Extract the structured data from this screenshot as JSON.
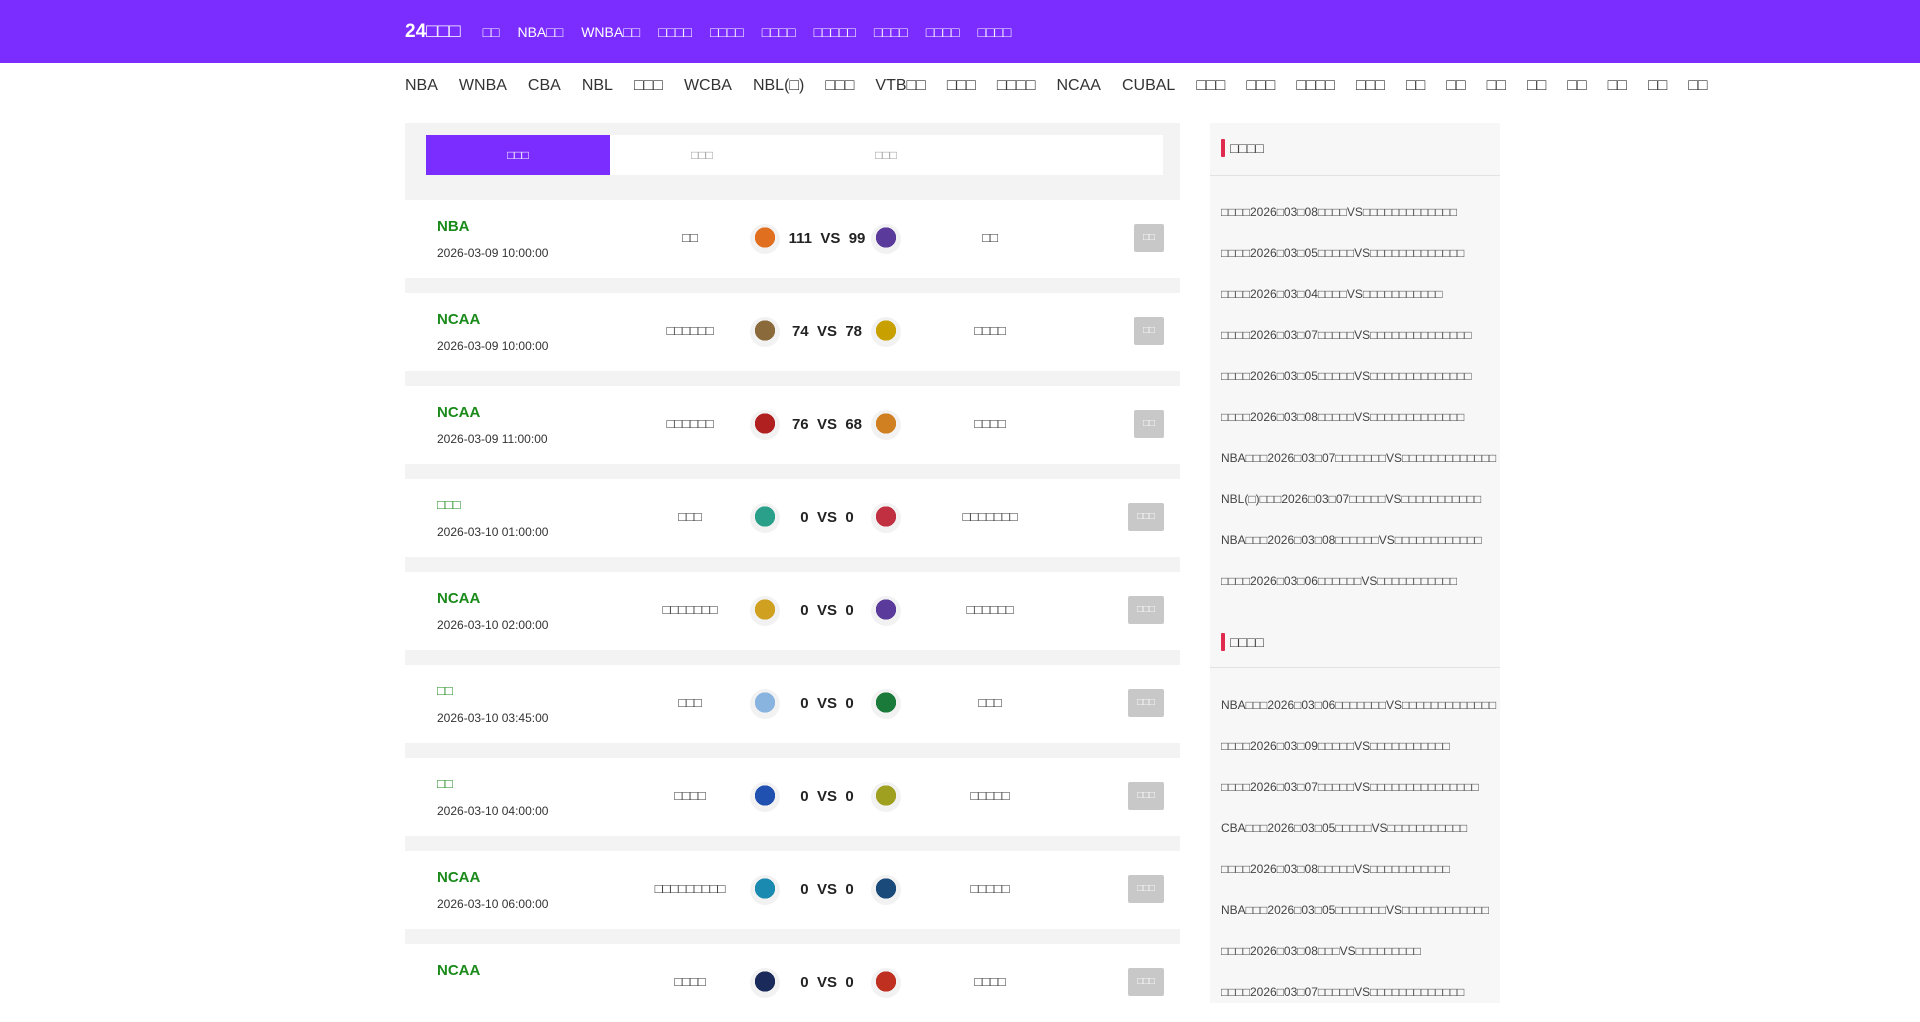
{
  "header": {
    "brand": "24□□□",
    "nav": [
      "□□",
      "NBA□□",
      "WNBA□□",
      "□□□□",
      "□□□□",
      "□□□□",
      "□□□□□",
      "□□□□",
      "□□□□",
      "□□□□"
    ]
  },
  "leagues": [
    "NBA",
    "WNBA",
    "CBA",
    "NBL",
    "□□□",
    "WCBA",
    "NBL(□)",
    "□□□",
    "VTB□□",
    "□□□",
    "□□□□",
    "NCAA",
    "CUBAL",
    "□□□",
    "□□□",
    "□□□□",
    "□□□",
    "□□",
    "□□",
    "□□",
    "□□",
    "□□",
    "□□",
    "□□",
    "□□"
  ],
  "tabs": [
    "□□□",
    "□□□",
    "□□□"
  ],
  "matches": [
    {
      "league": "NBA",
      "time": "2026-03-09 10:00:00",
      "home": "□□",
      "home_score": "111",
      "vs": "VS",
      "away_score": "99",
      "away": "□□",
      "button": "□□",
      "logo_home_color": "#e07020",
      "logo_away_color": "#5a3a9a"
    },
    {
      "league": "NCAA",
      "time": "2026-03-09 10:00:00",
      "home": "□□□□□□",
      "home_score": "74",
      "vs": "VS",
      "away_score": "78",
      "away": "□□□□",
      "button": "□□",
      "logo_home_color": "#8a6a3a",
      "logo_away_color": "#c8a000"
    },
    {
      "league": "NCAA",
      "time": "2026-03-09 11:00:00",
      "home": "□□□□□□",
      "home_score": "76",
      "vs": "VS",
      "away_score": "68",
      "away": "□□□□",
      "button": "□□",
      "logo_home_color": "#b02020",
      "logo_away_color": "#d08020"
    },
    {
      "league": "□□□",
      "time": "2026-03-10 01:00:00",
      "home": "□□□",
      "home_score": "0",
      "vs": "VS",
      "away_score": "0",
      "away": "□□□□□□□",
      "button": "□□□",
      "logo_home_color": "#2aa08a",
      "logo_away_color": "#c03040"
    },
    {
      "league": "NCAA",
      "time": "2026-03-10 02:00:00",
      "home": "□□□□□□□",
      "home_score": "0",
      "vs": "VS",
      "away_score": "0",
      "away": "□□□□□□",
      "button": "□□□",
      "logo_home_color": "#d0a020",
      "logo_away_color": "#5a3a9a"
    },
    {
      "league": "□□",
      "time": "2026-03-10 03:45:00",
      "home": "□□□",
      "home_score": "0",
      "vs": "VS",
      "away_score": "0",
      "away": "□□□",
      "button": "□□□",
      "logo_home_color": "#8ab4e0",
      "logo_away_color": "#1a7a3a"
    },
    {
      "league": "□□",
      "time": "2026-03-10 04:00:00",
      "home": "□□□□",
      "home_score": "0",
      "vs": "VS",
      "away_score": "0",
      "away": "□□□□□",
      "button": "□□□",
      "logo_home_color": "#2050b0",
      "logo_away_color": "#a0a020"
    },
    {
      "league": "NCAA",
      "time": "2026-03-10 06:00:00",
      "home": "□□□□□□□□□",
      "home_score": "0",
      "vs": "VS",
      "away_score": "0",
      "away": "□□□□□",
      "button": "□□□",
      "logo_home_color": "#1a8ab0",
      "logo_away_color": "#1a4a7a"
    },
    {
      "league": "NCAA",
      "time": "",
      "home": "□□□□",
      "home_score": "0",
      "vs": "VS",
      "away_score": "0",
      "away": "□□□□",
      "button": "□□□",
      "logo_home_color": "#1a2a5a",
      "logo_away_color": "#c03020"
    }
  ],
  "sidebar": {
    "section1_title": "□□□□",
    "section1_items": [
      "□□□□2026□03□08□□□□VS□□□□□□□□□□□□□",
      "□□□□2026□03□05□□□□□VS□□□□□□□□□□□□□",
      "□□□□2026□03□04□□□□VS□□□□□□□□□□□",
      "□□□□2026□03□07□□□□□VS□□□□□□□□□□□□□□",
      "□□□□2026□03□05□□□□□VS□□□□□□□□□□□□□□",
      "□□□□2026□03□08□□□□□VS□□□□□□□□□□□□□",
      "NBA□□□2026□03□07□□□□□□□VS□□□□□□□□□□□□□",
      "NBL(□)□□□2026□03□07□□□□□VS□□□□□□□□□□□",
      "NBA□□□2026□03□08□□□□□□VS□□□□□□□□□□□□",
      "□□□□2026□03□06□□□□□□VS□□□□□□□□□□□"
    ],
    "section2_title": "□□□□",
    "section2_items": [
      "NBA□□□2026□03□06□□□□□□□VS□□□□□□□□□□□□□",
      "□□□□2026□03□09□□□□□VS□□□□□□□□□□□",
      "□□□□2026□03□07□□□□□VS□□□□□□□□□□□□□□□",
      "CBA□□□2026□03□05□□□□□VS□□□□□□□□□□□",
      "□□□□2026□03□08□□□□□VS□□□□□□□□□□□",
      "NBA□□□2026□03□05□□□□□□□VS□□□□□□□□□□□□",
      "□□□□2026□03□08□□□VS□□□□□□□□□",
      "□□□□2026□03□07□□□□□VS□□□□□□□□□□□□□"
    ]
  }
}
